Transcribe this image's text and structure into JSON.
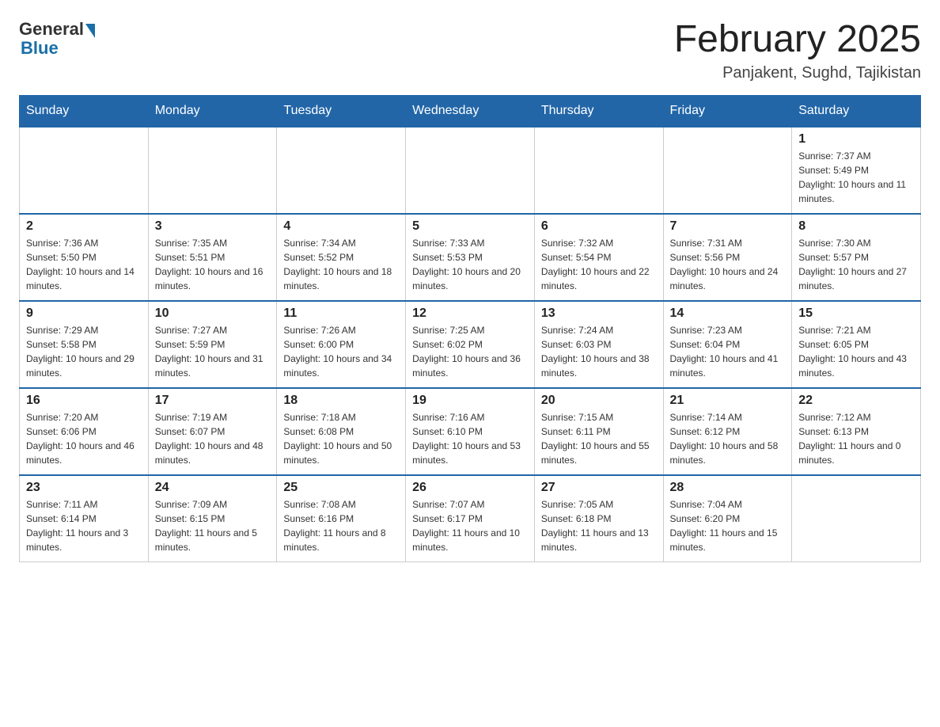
{
  "header": {
    "logo_general": "General",
    "logo_blue": "Blue",
    "month_title": "February 2025",
    "location": "Panjakent, Sughd, Tajikistan"
  },
  "weekdays": [
    "Sunday",
    "Monday",
    "Tuesday",
    "Wednesday",
    "Thursday",
    "Friday",
    "Saturday"
  ],
  "weeks": [
    [
      {
        "day": "",
        "info": ""
      },
      {
        "day": "",
        "info": ""
      },
      {
        "day": "",
        "info": ""
      },
      {
        "day": "",
        "info": ""
      },
      {
        "day": "",
        "info": ""
      },
      {
        "day": "",
        "info": ""
      },
      {
        "day": "1",
        "info": "Sunrise: 7:37 AM\nSunset: 5:49 PM\nDaylight: 10 hours and 11 minutes."
      }
    ],
    [
      {
        "day": "2",
        "info": "Sunrise: 7:36 AM\nSunset: 5:50 PM\nDaylight: 10 hours and 14 minutes."
      },
      {
        "day": "3",
        "info": "Sunrise: 7:35 AM\nSunset: 5:51 PM\nDaylight: 10 hours and 16 minutes."
      },
      {
        "day": "4",
        "info": "Sunrise: 7:34 AM\nSunset: 5:52 PM\nDaylight: 10 hours and 18 minutes."
      },
      {
        "day": "5",
        "info": "Sunrise: 7:33 AM\nSunset: 5:53 PM\nDaylight: 10 hours and 20 minutes."
      },
      {
        "day": "6",
        "info": "Sunrise: 7:32 AM\nSunset: 5:54 PM\nDaylight: 10 hours and 22 minutes."
      },
      {
        "day": "7",
        "info": "Sunrise: 7:31 AM\nSunset: 5:56 PM\nDaylight: 10 hours and 24 minutes."
      },
      {
        "day": "8",
        "info": "Sunrise: 7:30 AM\nSunset: 5:57 PM\nDaylight: 10 hours and 27 minutes."
      }
    ],
    [
      {
        "day": "9",
        "info": "Sunrise: 7:29 AM\nSunset: 5:58 PM\nDaylight: 10 hours and 29 minutes."
      },
      {
        "day": "10",
        "info": "Sunrise: 7:27 AM\nSunset: 5:59 PM\nDaylight: 10 hours and 31 minutes."
      },
      {
        "day": "11",
        "info": "Sunrise: 7:26 AM\nSunset: 6:00 PM\nDaylight: 10 hours and 34 minutes."
      },
      {
        "day": "12",
        "info": "Sunrise: 7:25 AM\nSunset: 6:02 PM\nDaylight: 10 hours and 36 minutes."
      },
      {
        "day": "13",
        "info": "Sunrise: 7:24 AM\nSunset: 6:03 PM\nDaylight: 10 hours and 38 minutes."
      },
      {
        "day": "14",
        "info": "Sunrise: 7:23 AM\nSunset: 6:04 PM\nDaylight: 10 hours and 41 minutes."
      },
      {
        "day": "15",
        "info": "Sunrise: 7:21 AM\nSunset: 6:05 PM\nDaylight: 10 hours and 43 minutes."
      }
    ],
    [
      {
        "day": "16",
        "info": "Sunrise: 7:20 AM\nSunset: 6:06 PM\nDaylight: 10 hours and 46 minutes."
      },
      {
        "day": "17",
        "info": "Sunrise: 7:19 AM\nSunset: 6:07 PM\nDaylight: 10 hours and 48 minutes."
      },
      {
        "day": "18",
        "info": "Sunrise: 7:18 AM\nSunset: 6:08 PM\nDaylight: 10 hours and 50 minutes."
      },
      {
        "day": "19",
        "info": "Sunrise: 7:16 AM\nSunset: 6:10 PM\nDaylight: 10 hours and 53 minutes."
      },
      {
        "day": "20",
        "info": "Sunrise: 7:15 AM\nSunset: 6:11 PM\nDaylight: 10 hours and 55 minutes."
      },
      {
        "day": "21",
        "info": "Sunrise: 7:14 AM\nSunset: 6:12 PM\nDaylight: 10 hours and 58 minutes."
      },
      {
        "day": "22",
        "info": "Sunrise: 7:12 AM\nSunset: 6:13 PM\nDaylight: 11 hours and 0 minutes."
      }
    ],
    [
      {
        "day": "23",
        "info": "Sunrise: 7:11 AM\nSunset: 6:14 PM\nDaylight: 11 hours and 3 minutes."
      },
      {
        "day": "24",
        "info": "Sunrise: 7:09 AM\nSunset: 6:15 PM\nDaylight: 11 hours and 5 minutes."
      },
      {
        "day": "25",
        "info": "Sunrise: 7:08 AM\nSunset: 6:16 PM\nDaylight: 11 hours and 8 minutes."
      },
      {
        "day": "26",
        "info": "Sunrise: 7:07 AM\nSunset: 6:17 PM\nDaylight: 11 hours and 10 minutes."
      },
      {
        "day": "27",
        "info": "Sunrise: 7:05 AM\nSunset: 6:18 PM\nDaylight: 11 hours and 13 minutes."
      },
      {
        "day": "28",
        "info": "Sunrise: 7:04 AM\nSunset: 6:20 PM\nDaylight: 11 hours and 15 minutes."
      },
      {
        "day": "",
        "info": ""
      }
    ]
  ]
}
